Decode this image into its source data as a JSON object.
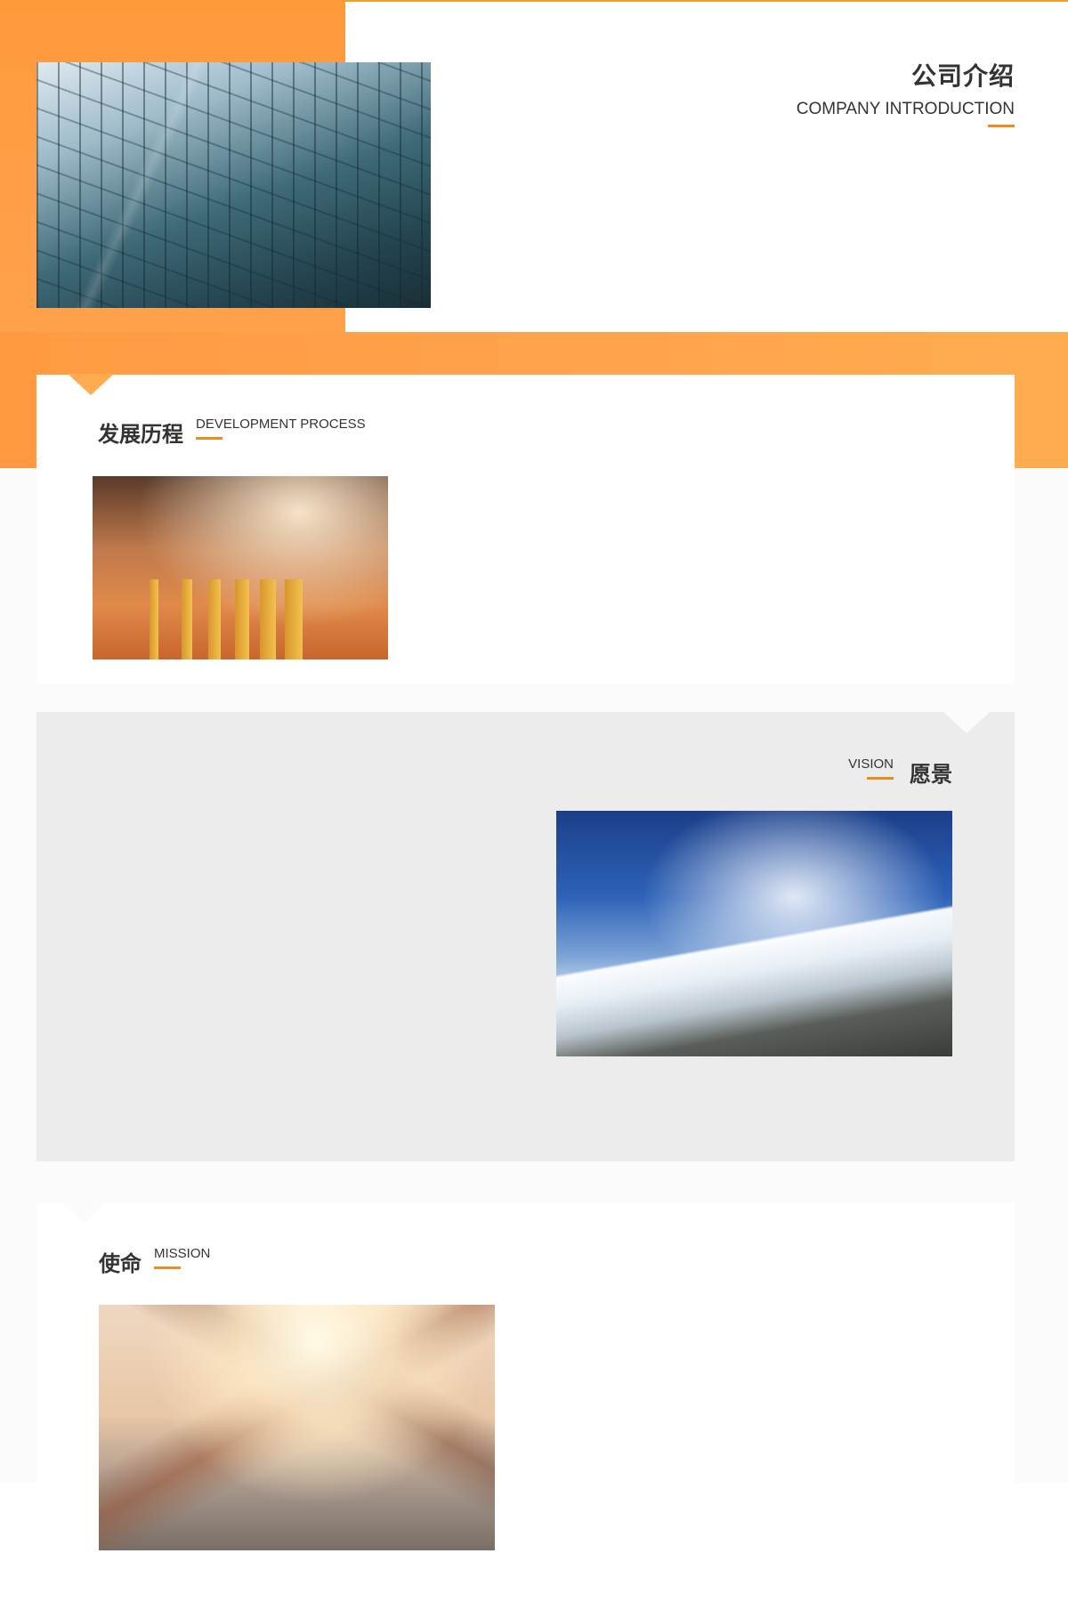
{
  "intro": {
    "title": "公司介绍",
    "subtitle": "COMPANY INTRODUCTION"
  },
  "development": {
    "title_cn": "发展历程",
    "title_en": "DEVELOPMENT PROCESS"
  },
  "vision": {
    "title_cn": "愿景",
    "title_en": "VISION"
  },
  "mission": {
    "title_cn": "使命",
    "title_en": "MISSION"
  },
  "colors": {
    "accent": "#f08a1c",
    "orange_bg": "#ffa24c",
    "panel_gray": "#ececec"
  }
}
